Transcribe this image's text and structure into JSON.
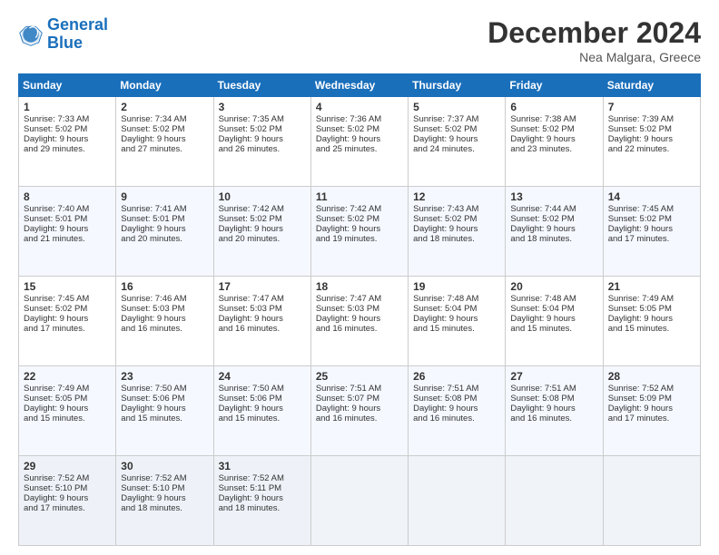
{
  "header": {
    "logo_line1": "General",
    "logo_line2": "Blue",
    "month_title": "December 2024",
    "location": "Nea Malgara, Greece"
  },
  "weekdays": [
    "Sunday",
    "Monday",
    "Tuesday",
    "Wednesday",
    "Thursday",
    "Friday",
    "Saturday"
  ],
  "weeks": [
    [
      {
        "day": "1",
        "lines": [
          "Sunrise: 7:33 AM",
          "Sunset: 5:02 PM",
          "Daylight: 9 hours",
          "and 29 minutes."
        ]
      },
      {
        "day": "2",
        "lines": [
          "Sunrise: 7:34 AM",
          "Sunset: 5:02 PM",
          "Daylight: 9 hours",
          "and 27 minutes."
        ]
      },
      {
        "day": "3",
        "lines": [
          "Sunrise: 7:35 AM",
          "Sunset: 5:02 PM",
          "Daylight: 9 hours",
          "and 26 minutes."
        ]
      },
      {
        "day": "4",
        "lines": [
          "Sunrise: 7:36 AM",
          "Sunset: 5:02 PM",
          "Daylight: 9 hours",
          "and 25 minutes."
        ]
      },
      {
        "day": "5",
        "lines": [
          "Sunrise: 7:37 AM",
          "Sunset: 5:02 PM",
          "Daylight: 9 hours",
          "and 24 minutes."
        ]
      },
      {
        "day": "6",
        "lines": [
          "Sunrise: 7:38 AM",
          "Sunset: 5:02 PM",
          "Daylight: 9 hours",
          "and 23 minutes."
        ]
      },
      {
        "day": "7",
        "lines": [
          "Sunrise: 7:39 AM",
          "Sunset: 5:02 PM",
          "Daylight: 9 hours",
          "and 22 minutes."
        ]
      }
    ],
    [
      {
        "day": "8",
        "lines": [
          "Sunrise: 7:40 AM",
          "Sunset: 5:01 PM",
          "Daylight: 9 hours",
          "and 21 minutes."
        ]
      },
      {
        "day": "9",
        "lines": [
          "Sunrise: 7:41 AM",
          "Sunset: 5:01 PM",
          "Daylight: 9 hours",
          "and 20 minutes."
        ]
      },
      {
        "day": "10",
        "lines": [
          "Sunrise: 7:42 AM",
          "Sunset: 5:02 PM",
          "Daylight: 9 hours",
          "and 20 minutes."
        ]
      },
      {
        "day": "11",
        "lines": [
          "Sunrise: 7:42 AM",
          "Sunset: 5:02 PM",
          "Daylight: 9 hours",
          "and 19 minutes."
        ]
      },
      {
        "day": "12",
        "lines": [
          "Sunrise: 7:43 AM",
          "Sunset: 5:02 PM",
          "Daylight: 9 hours",
          "and 18 minutes."
        ]
      },
      {
        "day": "13",
        "lines": [
          "Sunrise: 7:44 AM",
          "Sunset: 5:02 PM",
          "Daylight: 9 hours",
          "and 18 minutes."
        ]
      },
      {
        "day": "14",
        "lines": [
          "Sunrise: 7:45 AM",
          "Sunset: 5:02 PM",
          "Daylight: 9 hours",
          "and 17 minutes."
        ]
      }
    ],
    [
      {
        "day": "15",
        "lines": [
          "Sunrise: 7:45 AM",
          "Sunset: 5:02 PM",
          "Daylight: 9 hours",
          "and 17 minutes."
        ]
      },
      {
        "day": "16",
        "lines": [
          "Sunrise: 7:46 AM",
          "Sunset: 5:03 PM",
          "Daylight: 9 hours",
          "and 16 minutes."
        ]
      },
      {
        "day": "17",
        "lines": [
          "Sunrise: 7:47 AM",
          "Sunset: 5:03 PM",
          "Daylight: 9 hours",
          "and 16 minutes."
        ]
      },
      {
        "day": "18",
        "lines": [
          "Sunrise: 7:47 AM",
          "Sunset: 5:03 PM",
          "Daylight: 9 hours",
          "and 16 minutes."
        ]
      },
      {
        "day": "19",
        "lines": [
          "Sunrise: 7:48 AM",
          "Sunset: 5:04 PM",
          "Daylight: 9 hours",
          "and 15 minutes."
        ]
      },
      {
        "day": "20",
        "lines": [
          "Sunrise: 7:48 AM",
          "Sunset: 5:04 PM",
          "Daylight: 9 hours",
          "and 15 minutes."
        ]
      },
      {
        "day": "21",
        "lines": [
          "Sunrise: 7:49 AM",
          "Sunset: 5:05 PM",
          "Daylight: 9 hours",
          "and 15 minutes."
        ]
      }
    ],
    [
      {
        "day": "22",
        "lines": [
          "Sunrise: 7:49 AM",
          "Sunset: 5:05 PM",
          "Daylight: 9 hours",
          "and 15 minutes."
        ]
      },
      {
        "day": "23",
        "lines": [
          "Sunrise: 7:50 AM",
          "Sunset: 5:06 PM",
          "Daylight: 9 hours",
          "and 15 minutes."
        ]
      },
      {
        "day": "24",
        "lines": [
          "Sunrise: 7:50 AM",
          "Sunset: 5:06 PM",
          "Daylight: 9 hours",
          "and 15 minutes."
        ]
      },
      {
        "day": "25",
        "lines": [
          "Sunrise: 7:51 AM",
          "Sunset: 5:07 PM",
          "Daylight: 9 hours",
          "and 16 minutes."
        ]
      },
      {
        "day": "26",
        "lines": [
          "Sunrise: 7:51 AM",
          "Sunset: 5:08 PM",
          "Daylight: 9 hours",
          "and 16 minutes."
        ]
      },
      {
        "day": "27",
        "lines": [
          "Sunrise: 7:51 AM",
          "Sunset: 5:08 PM",
          "Daylight: 9 hours",
          "and 16 minutes."
        ]
      },
      {
        "day": "28",
        "lines": [
          "Sunrise: 7:52 AM",
          "Sunset: 5:09 PM",
          "Daylight: 9 hours",
          "and 17 minutes."
        ]
      }
    ],
    [
      {
        "day": "29",
        "lines": [
          "Sunrise: 7:52 AM",
          "Sunset: 5:10 PM",
          "Daylight: 9 hours",
          "and 17 minutes."
        ]
      },
      {
        "day": "30",
        "lines": [
          "Sunrise: 7:52 AM",
          "Sunset: 5:10 PM",
          "Daylight: 9 hours",
          "and 18 minutes."
        ]
      },
      {
        "day": "31",
        "lines": [
          "Sunrise: 7:52 AM",
          "Sunset: 5:11 PM",
          "Daylight: 9 hours",
          "and 18 minutes."
        ]
      },
      null,
      null,
      null,
      null
    ]
  ]
}
